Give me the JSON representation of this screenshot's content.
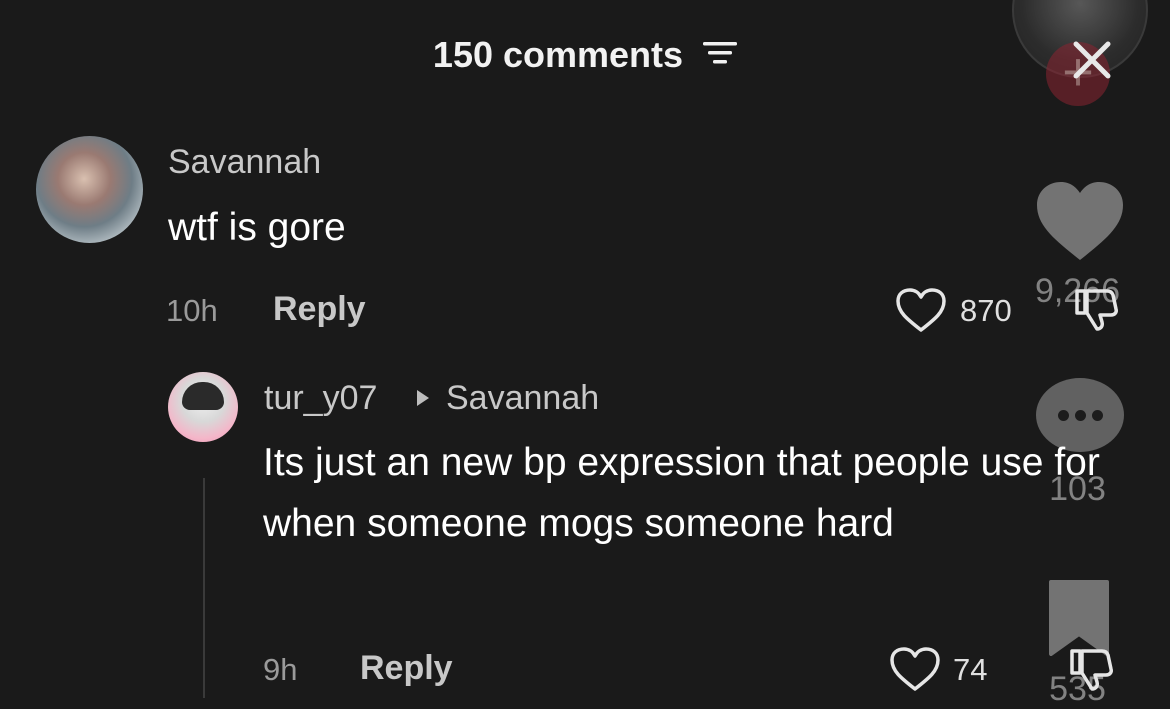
{
  "header": {
    "title": "150 comments",
    "filter_icon": "filter-icon"
  },
  "side_rail": {
    "like_count": "9,266",
    "comment_count": "103",
    "save_count": "535"
  },
  "comments": [
    {
      "username": "Savannah",
      "text": "wtf is gore",
      "time": "10h",
      "reply_label": "Reply",
      "likes": "870"
    },
    {
      "username": "tur_y07",
      "reply_to": "Savannah",
      "text": "Its just an new bp expression that people use for when someone mogs someone hard",
      "time": "9h",
      "reply_label": "Reply",
      "likes": "74"
    }
  ],
  "colors": {
    "background": "#1a1a1a",
    "text": "#ffffff",
    "muted": "#9a9a9a",
    "follow": "#8a2431"
  }
}
